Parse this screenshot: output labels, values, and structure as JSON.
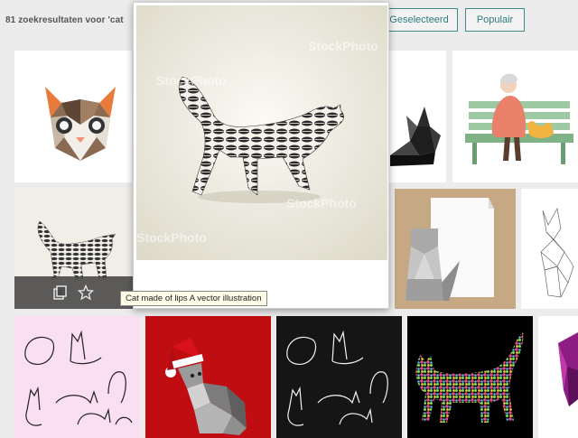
{
  "header": {
    "result_count": "81 zoekresultaten voor 'cat",
    "sort_selected_label": "Geselecteerd",
    "sort_popular_label": "Populair"
  },
  "preview": {
    "watermark": "StockPhoto",
    "tooltip": "Cat made of lips A vector illustration"
  },
  "hover_bar": {
    "collections_icon": "copy-icon",
    "favorite_icon": "star-icon"
  },
  "tiles": [
    {
      "subject": "geometric-cat-face"
    },
    {
      "subject": "origami-black-cat"
    },
    {
      "subject": "old-lady-on-bench-with-cats"
    },
    {
      "subject": "cat-made-of-lips"
    },
    {
      "subject": "origami-paper-cat"
    },
    {
      "subject": "wireframe-cat"
    },
    {
      "subject": "cat-line-sketches-pink"
    },
    {
      "subject": "low-poly-cat-santa-hat"
    },
    {
      "subject": "cat-line-sketches-black"
    },
    {
      "subject": "dotted-colorful-cat"
    },
    {
      "subject": "purple-cat-partial"
    }
  ]
}
